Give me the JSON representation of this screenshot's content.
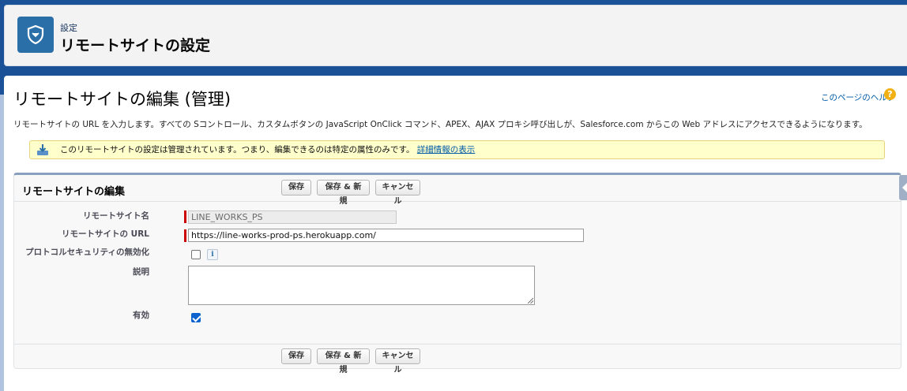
{
  "header": {
    "subtitle": "設定",
    "title": "リモートサイトの設定",
    "icon": "shield-icon",
    "accent": "#2a6fa8"
  },
  "page": {
    "title": "リモートサイトの編集 (管理)",
    "help_link": "このページのヘルプ",
    "description": "リモートサイトの URL を入力します。すべての Sコントロール、カスタムボタンの JavaScript OnClick コマンド、APEX、AJAX プロキシ呼び出しが、Salesforce.com からこの Web アドレスにアクセスできるようになります。"
  },
  "notice": {
    "text": "このリモートサイトの設定は管理されています。つまり、編集できるのは特定の属性のみです。",
    "link": "詳細情報の表示",
    "icon": "download-icon"
  },
  "form": {
    "title": "リモートサイトの編集",
    "buttons": {
      "save": "保存",
      "save_new": "保存 & 新規",
      "cancel": "キャンセル"
    },
    "fields": {
      "site_name_label": "リモートサイト名",
      "site_name_value": "LINE_WORKS_PS",
      "url_label": "リモートサイトの URL",
      "url_value": "https://line-works-prod-ps.herokuapp.com/",
      "protocol_label": "プロトコルセキュリティの無効化",
      "protocol_checked": false,
      "description_label": "説明",
      "description_value": "",
      "active_label": "有効",
      "active_checked": true
    }
  },
  "colors": {
    "brand_bg": "#1b5297",
    "required": "#cc0000",
    "link": "#015ba7",
    "notice_bg": "#ffffcc"
  }
}
